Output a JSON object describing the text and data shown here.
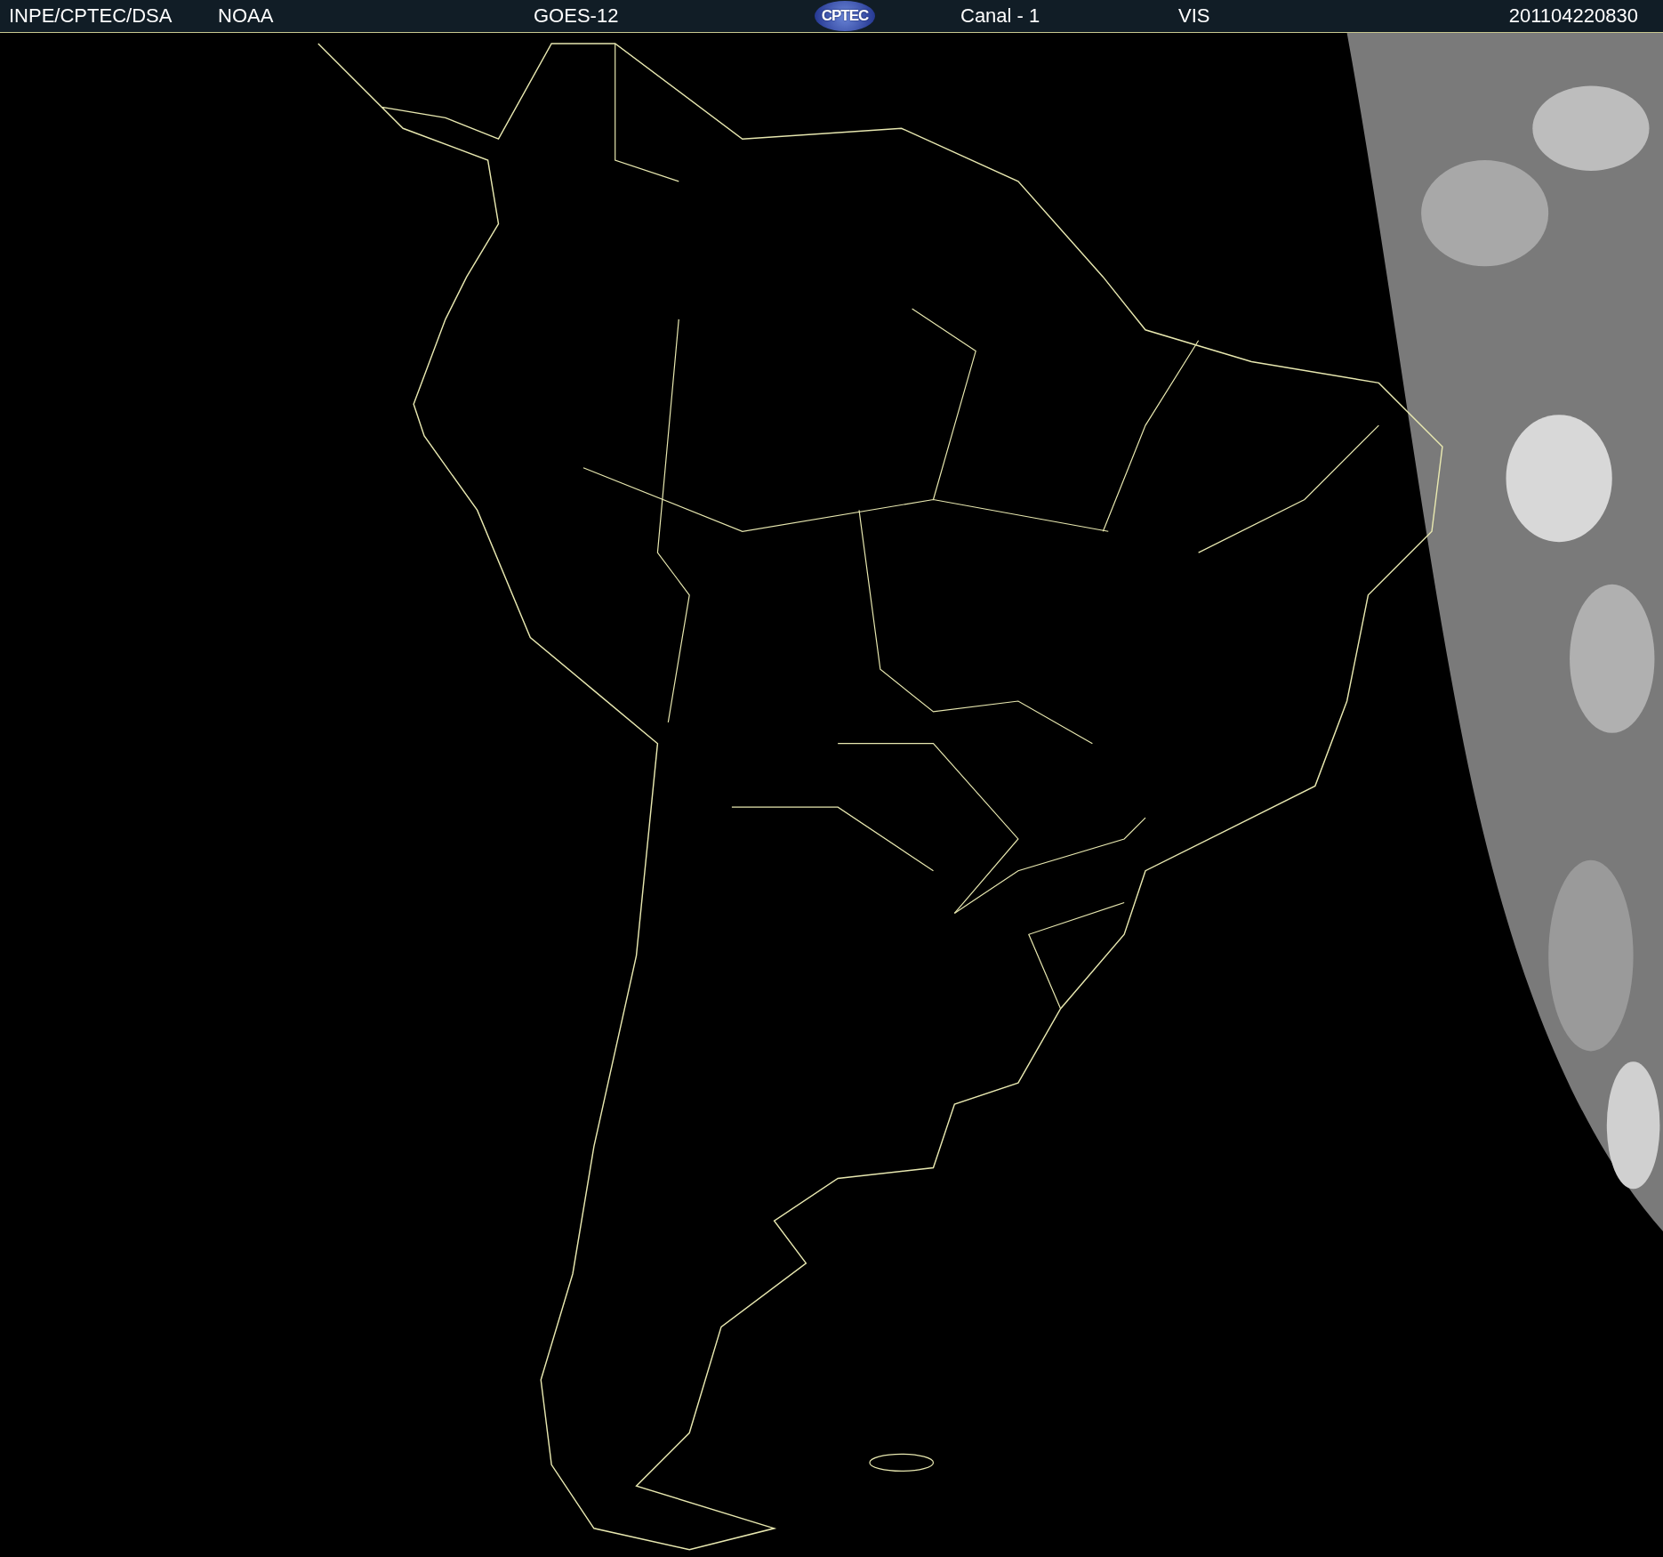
{
  "header": {
    "source": "INPE/CPTEC/DSA",
    "agency": "NOAA",
    "satellite": "GOES-12",
    "logo": "CPTEC",
    "channel": "Canal - 1",
    "band": "VIS",
    "timestamp": "201104220830"
  }
}
